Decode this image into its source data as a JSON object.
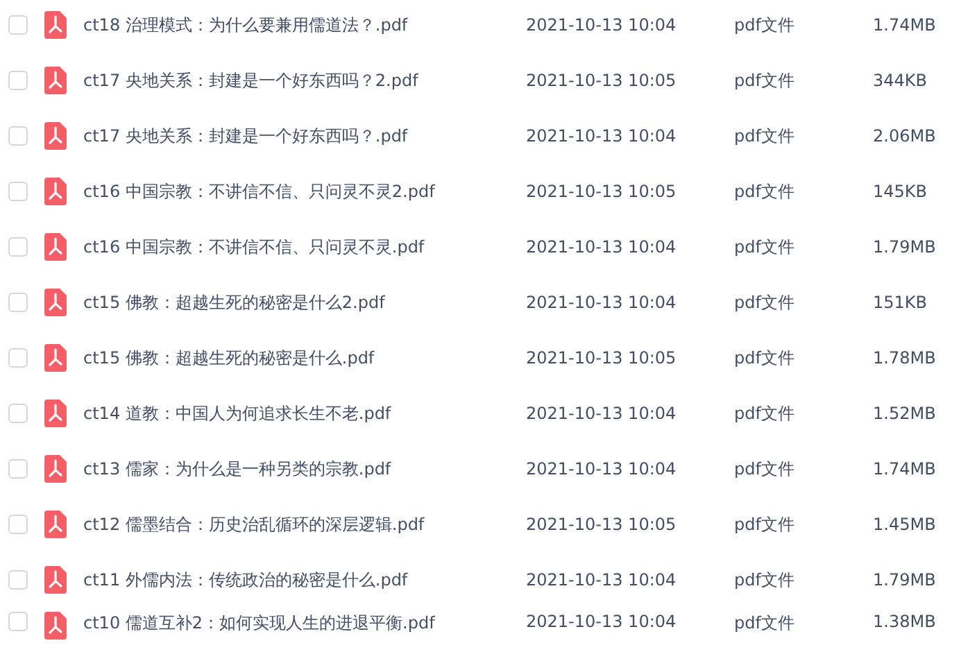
{
  "files": [
    {
      "name": "ct18 治理模式：为什么要兼用儒道法？.pdf",
      "modified": "2021-10-13 10:04",
      "type": "pdf文件",
      "size": "1.74MB",
      "checked": false
    },
    {
      "name": "ct17 央地关系：封建是一个好东西吗？2.pdf",
      "modified": "2021-10-13 10:05",
      "type": "pdf文件",
      "size": "344KB",
      "checked": false
    },
    {
      "name": "ct17 央地关系：封建是一个好东西吗？.pdf",
      "modified": "2021-10-13 10:04",
      "type": "pdf文件",
      "size": "2.06MB",
      "checked": false
    },
    {
      "name": "ct16 中国宗教：不讲信不信、只问灵不灵2.pdf",
      "modified": "2021-10-13 10:05",
      "type": "pdf文件",
      "size": "145KB",
      "checked": false
    },
    {
      "name": "ct16 中国宗教：不讲信不信、只问灵不灵.pdf",
      "modified": "2021-10-13 10:04",
      "type": "pdf文件",
      "size": "1.79MB",
      "checked": false
    },
    {
      "name": "ct15 佛教：超越生死的秘密是什么2.pdf",
      "modified": "2021-10-13 10:04",
      "type": "pdf文件",
      "size": "151KB",
      "checked": false
    },
    {
      "name": "ct15 佛教：超越生死的秘密是什么.pdf",
      "modified": "2021-10-13 10:05",
      "type": "pdf文件",
      "size": "1.78MB",
      "checked": false
    },
    {
      "name": "ct14 道教：中国人为何追求长生不老.pdf",
      "modified": "2021-10-13 10:04",
      "type": "pdf文件",
      "size": "1.52MB",
      "checked": false
    },
    {
      "name": "ct13 儒家：为什么是一种另类的宗教.pdf",
      "modified": "2021-10-13 10:04",
      "type": "pdf文件",
      "size": "1.74MB",
      "checked": false
    },
    {
      "name": "ct12 儒墨结合：历史治乱循环的深层逻辑.pdf",
      "modified": "2021-10-13 10:05",
      "type": "pdf文件",
      "size": "1.45MB",
      "checked": false
    },
    {
      "name": "ct11 外儒内法：传统政治的秘密是什么.pdf",
      "modified": "2021-10-13 10:04",
      "type": "pdf文件",
      "size": "1.79MB",
      "checked": false
    },
    {
      "name": "ct10 儒道互补2：如何实现人生的进退平衡.pdf",
      "modified": "2021-10-13 10:04",
      "type": "pdf文件",
      "size": "1.38MB",
      "checked": false
    }
  ]
}
